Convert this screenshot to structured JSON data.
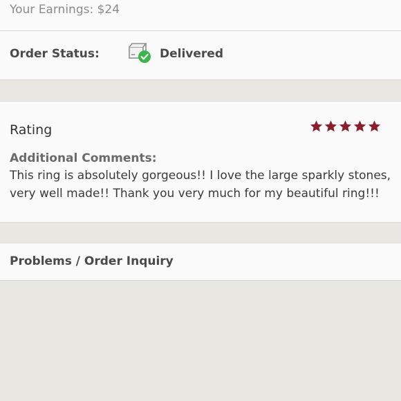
{
  "earnings": {
    "text": "Your Earnings: $24"
  },
  "order_status": {
    "label": "Order Status:",
    "value": "Delivered",
    "icon": "package-delivered-icon",
    "check_color": "#3ab54a"
  },
  "rating": {
    "label": "Rating",
    "stars": 5,
    "max_stars": 5,
    "star_color": "#8a1e2c",
    "comments_heading": "Additional Comments:",
    "comments_text": "This ring is absolutely gorgeous!! I love the large sparkly stones, very well made!! Thank you very much for my beautiful ring!!!"
  },
  "problems": {
    "label": "Problems / Order Inquiry"
  }
}
